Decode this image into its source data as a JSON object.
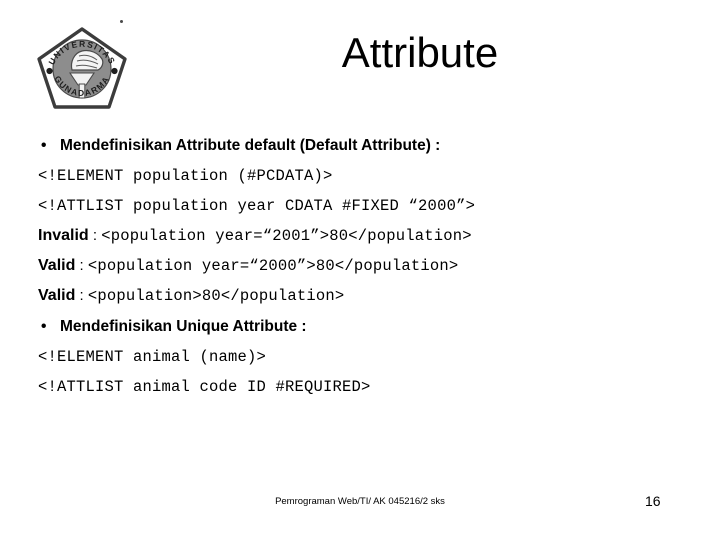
{
  "slide": {
    "title": "Attribute",
    "logo": {
      "alt": "Universitas Gunadarma logo",
      "top_text": "UNIVERSITAS",
      "bottom_text": "GUNADARMA"
    },
    "content_lines": [
      {
        "kind": "bullet",
        "bullet": "•",
        "text": "Mendefinisikan Attribute default (Default Attribute) :"
      },
      {
        "kind": "code",
        "text": "<!ELEMENT population (#PCDATA)>"
      },
      {
        "kind": "code",
        "text": "<!ATTLIST population year CDATA #FIXED “2000”>"
      },
      {
        "kind": "mix",
        "label": "Invalid",
        "separator": " : ",
        "code": "<population year=“2001”>80</population>"
      },
      {
        "kind": "mix",
        "label": "Valid",
        "separator": " : ",
        "code": "<population year=“2000”>80</population>"
      },
      {
        "kind": "mix",
        "label": "Valid",
        "separator": " : ",
        "code": "<population>80</population>"
      },
      {
        "kind": "bullet",
        "bullet": "•",
        "text": "Mendefinisikan Unique  Attribute :"
      },
      {
        "kind": "code",
        "text": "<!ELEMENT animal (name)>"
      },
      {
        "kind": "code",
        "text": "<!ATTLIST animal code ID #REQUIRED>"
      }
    ],
    "footer": {
      "note": "Pemrograman Web/TI/ AK 045216/2 sks",
      "page_number": "16"
    },
    "colors": {
      "background": "#ffffff",
      "text": "#000000",
      "logo_outline": "#3c3c3c",
      "logo_fill": "#8a8a8a"
    }
  }
}
